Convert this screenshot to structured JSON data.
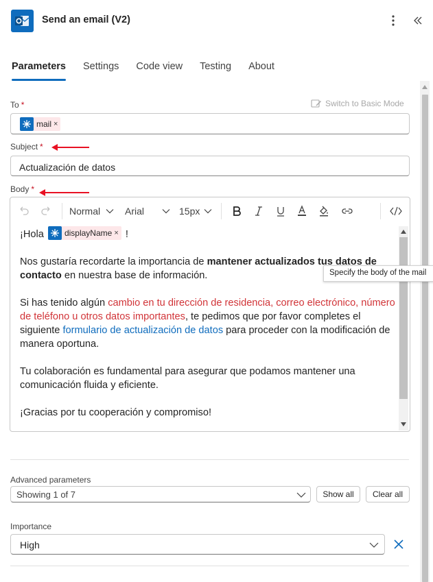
{
  "header": {
    "title": "Send an email (V2)",
    "icon": "outlook-icon"
  },
  "tabs": [
    {
      "label": "Parameters",
      "active": true
    },
    {
      "label": "Settings",
      "active": false
    },
    {
      "label": "Code view",
      "active": false
    },
    {
      "label": "Testing",
      "active": false
    },
    {
      "label": "About",
      "active": false
    }
  ],
  "to": {
    "label": "To",
    "required": "*",
    "token": "mail",
    "switch_label": "Switch to Basic Mode"
  },
  "subject": {
    "label": "Subject",
    "required": "*",
    "value": "Actualización de datos"
  },
  "body": {
    "label": "Body",
    "required": "*",
    "toolbar": {
      "format": "Normal",
      "font": "Arial",
      "size": "15px"
    },
    "greeting_prefix": "¡Hola",
    "greeting_token": "displayName",
    "greeting_suffix": "!",
    "p1_pre": "Nos gustaría recordarte la importancia de ",
    "p1_bold": "mantener actualizados tus datos de contacto",
    "p1_post": " en nuestra base de información.",
    "p2_pre": "Si has tenido algún ",
    "p2_red": "cambio en tu dirección de residencia, correo electrónico, número de teléfono u otros datos importantes",
    "p2_mid": ", te pedimos que por favor completes el siguiente ",
    "p2_link": "formulario de actualización de datos",
    "p2_post": " para proceder con la modificación de manera oportuna.",
    "p3": "Tu colaboración es fundamental para asegurar que podamos mantener una comunicación fluida y eficiente.",
    "p4": "¡Gracias por tu cooperación y compromiso!",
    "tooltip": "Specify the body of the mail"
  },
  "advanced": {
    "label": "Advanced parameters",
    "showing": "Showing 1 of 7",
    "show_all": "Show all",
    "clear_all": "Clear all"
  },
  "importance": {
    "label": "Importance",
    "value": "High"
  },
  "colors": {
    "accent": "#0f6cbd",
    "token_bg": "#fde7e9",
    "required": "#c50f1f",
    "annotation_arrow": "#e81123",
    "highlight_red": "#d13438"
  }
}
